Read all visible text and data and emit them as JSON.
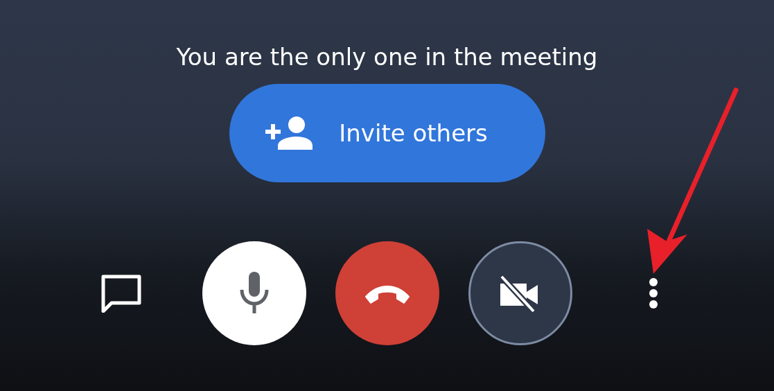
{
  "status_text": "You are the only one in the meeting",
  "invite_button": {
    "label": "Invite others"
  },
  "controls": [
    {
      "kind": "chat"
    },
    {
      "kind": "mic",
      "on": true
    },
    {
      "kind": "hangup"
    },
    {
      "kind": "camera",
      "on": false
    },
    {
      "kind": "more"
    }
  ],
  "annotation": {
    "kind": "arrow"
  }
}
